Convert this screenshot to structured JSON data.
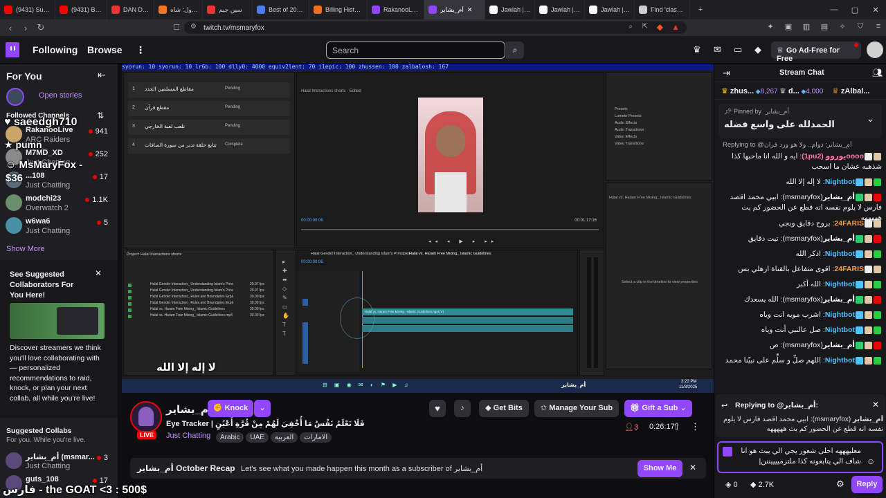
{
  "browser": {
    "tabs": [
      {
        "title": "(9431) Subscriptions",
        "color": "#ff0000"
      },
      {
        "title": "(9431) BEST OF",
        "color": "#ff0000"
      },
      {
        "title": "DAN DA DAN S",
        "color": "#e33"
      },
      {
        "title": "كرانشي رول: شاه",
        "color": "#f47521"
      },
      {
        "title": "سين جيم",
        "color": "#e33"
      },
      {
        "title": "Best of 2025: To",
        "color": "#4d7cf4"
      },
      {
        "title": "Billing History",
        "color": "#f26d21"
      },
      {
        "title": "RakanooLive",
        "color": "#9147ff"
      },
      {
        "title": "أم_بشاير",
        "color": "#9147ff",
        "active": true
      },
      {
        "title": "Jawlah | جولة -",
        "color": "#ffffff"
      },
      {
        "title": "Jawlah | جولة -",
        "color": "#ffffff"
      },
      {
        "title": "Jawlah | جولة -",
        "color": "#ffffff"
      },
      {
        "title": "Find 'class wars",
        "color": "#ccc"
      }
    ],
    "url": "twitch.tv/msmaryfox",
    "new_tab": "+",
    "minimize": "—",
    "maximize": "▢",
    "close": "✕"
  },
  "nav": {
    "following": "Following",
    "browse": "Browse",
    "more": "⋮",
    "search_placeholder": "Search",
    "adfree": "Go Ad-Free for Free"
  },
  "sidebar": {
    "for_you": "For You",
    "open_stories": "Open stories",
    "followed_channels": "Followed Channels",
    "channels": [
      {
        "name": "RakanooLive",
        "category": "ARC Raiders",
        "viewers": "941",
        "color": "#c9a66b"
      },
      {
        "name": "M7MD_XD",
        "category": "Just Chatting",
        "viewers": "252",
        "color": "#8a8a8a"
      },
      {
        "name": "...108",
        "category": "Just Chatting",
        "viewers": "17",
        "color": "#5a6b7a"
      },
      {
        "name": "modchi23",
        "category": "Overwatch 2",
        "viewers": "1.1K",
        "color": "#6b8e6b"
      },
      {
        "name": "w6wa6",
        "category": "Just Chatting",
        "viewers": "5",
        "color": "#4a90a4"
      }
    ],
    "show_more": "Show More",
    "suggest_title": "See Suggested Collaborators For You Here!",
    "suggest_body": "Discover streamers we think you'll love collaborating with — personalized recommendations to raid, knock, or plan your next collab, all while you're live!",
    "suggested_collabs": "Suggested Collabs",
    "suggested_sub": "For you. While you're live.",
    "collabs": [
      {
        "name": "أم_بشاير (msmar...",
        "category": "Just Chatting",
        "viewers": "3"
      },
      {
        "name": "guts_108",
        "category": "",
        "viewers": "17"
      }
    ]
  },
  "overlay": {
    "alert1": "saeedgh710",
    "alert2": "pumn_",
    "alert3": "MsMaryFox - $36",
    "bottom": "فارس - the GOAT <3 : 500$",
    "video_caption": "لا إله إلا الله"
  },
  "premiere": {
    "ticker": "syorun: 10  syorun: 10  lr6b: 100  dlly0: 4000  equiv2lent: 70  i1epic: 100  zhussen: 100  zalbalosh: 167",
    "queue": [
      {
        "n": "1",
        "title": "مقاطع المسلمين الجدد",
        "status": "Pending"
      },
      {
        "n": "2",
        "title": "مقطع قرآن",
        "status": "Pending"
      },
      {
        "n": "3",
        "title": "تلعب لعبة الخارجي",
        "status": "Pending"
      },
      {
        "n": "4",
        "title": "تتابع حلقة تدبر من سورة الصافات",
        "status": "Complete"
      }
    ],
    "program_title": "Halal Interactions shorts - Edited",
    "timecode_in": "00:00:00:06",
    "timecode_out": "00:01:17:16",
    "project_title": "Project: Halal Interactions shorts",
    "files": [
      "Halal Gender Interaction_ Understanding Islam's Principles",
      "Halal Gender Interaction_ Understanding Islam's Principles.mp4",
      "Halal Gender Interaction_ Rules and Boundaries Explained",
      "Halal Gender Interaction_ Rules and Boundaries Explained.mp4",
      "Halal vs. Haram Free Mixing_ Islamic Guidelines",
      "Halal vs. Haram Free Mixing_ Islamic Guidelines.mp4"
    ],
    "frame_rates": [
      "29.97 fps",
      "29.97 fps",
      "30.00 fps",
      "30.00 fps",
      "30.00 fps",
      "30.00 fps"
    ],
    "seq_tab1": "Halal Gender Interaction_ Understanding Islam's Principles",
    "seq_tab2": "Halal vs. Haram Free Mixing_ Islamic Guidelines",
    "clip_label": "Halal vs. Haram Free Mixing_ Islamic Guidelines.mp4 [V]",
    "properties": "Select a clip in the timeline to view properties",
    "properties_title": "Halal vs. Haram Free Mixing_ Islamic Guidelines",
    "effects": [
      "Presets",
      "Lumetri Presets",
      "Audio Effects",
      "Audio Transitions",
      "Video Effects",
      "Video Transitions"
    ],
    "taskbar_name": "أم_بشاير",
    "clock": "3:22 PM",
    "date": "11/3/2025"
  },
  "stream": {
    "channel": "أم_بشاير",
    "knock": "Knock",
    "title": "Eye Tracker | فَلَا تَعْلَمُ نَفْسٌ مَا أُخْفِيَ لَهُمْ مِنْ قُرَّةِ أَعْيُنٍ",
    "category": "Just Chatting",
    "tags": [
      "Arabic",
      "UAE",
      "العربية",
      "الامارات"
    ],
    "live": "LIVE",
    "get_bits": "Get Bits",
    "manage_sub": "Manage Your Sub",
    "gift_sub": "Gift a Sub",
    "viewers": "3",
    "uptime": "0:26:17",
    "recap_title": "أم_بشاير October Recap",
    "recap_body": "Let's see what you made happen this month as a subscriber of أم_بشاير",
    "show_me": "Show Me"
  },
  "chat": {
    "title": "Stream Chat",
    "leaderboard": [
      {
        "name": "zhus...",
        "amount": "8,267"
      },
      {
        "name": "d...",
        "amount": "4,000"
      },
      {
        "name": "zAlbal...",
        "amount": ""
      }
    ],
    "pinned_by": "Pinned by",
    "pinned_user": "أم_بشاير",
    "pinned_text": "الحمدلله على واسع فضله",
    "replying_line": "Replying to @أم_بشاير: دوام.. ولا هو ورد قرآن",
    "messages": [
      {
        "user": "ooooيوروو (1pu2)",
        "color": "#ff7bb0",
        "text": ": ايه و الله انا ماحبها كذا شذهبه عشان ما اسحب"
      },
      {
        "user": "Nightbot",
        "color": "#4ec4ff",
        "text": ": لا إله إلا الله"
      },
      {
        "user": "أم_بشاير",
        "color": "#ffffff",
        "text": "(msmaryfox): ابيي محمد اقصد فارس لا يلوم نفسه انه قطع عن الحضور كم بث هههههه"
      },
      {
        "user": "24FARIS",
        "color": "#ff9a3c",
        "text": ": بروح دقايق وبجي"
      },
      {
        "user": "أم_بشاير",
        "color": "#ffffff",
        "text": "(msmaryfox): تيت دقايق"
      },
      {
        "user": "Nightbot",
        "color": "#4ec4ff",
        "text": ": اذكر الله"
      },
      {
        "user": "24FARIS",
        "color": "#ff9a3c",
        "text": ": اقوى متفاعل بالقناة ازهلي بس"
      },
      {
        "user": "Nightbot",
        "color": "#4ec4ff",
        "text": ": الله أكبر"
      },
      {
        "user": "أم_بشاير",
        "color": "#ffffff",
        "text": "(msmaryfox): الله يسعدك"
      },
      {
        "user": "Nightbot",
        "color": "#4ec4ff",
        "text": ": اشرب مويه انت وياه"
      },
      {
        "user": "Nightbot",
        "color": "#4ec4ff",
        "text": ": صل عالنبي أنت وياه"
      },
      {
        "user": "أم_بشاير",
        "color": "#ffffff",
        "text": "(msmaryfox): ص"
      },
      {
        "user": "Nightbot",
        "color": "#4ec4ff",
        "text": ": اللهم صلِّ و سلِّم على نبيّنا محمد"
      }
    ],
    "reply_header": "Replying to @أم_بشاير:",
    "reply_quote": "ابيي محمد اقصد فارس لا يلوم نفسه انه قطع عن الحضور كم بث هههههه",
    "reply_user": "أم_بشاير",
    "reply_user_handle": "(msmaryfox):",
    "input_text": "معليهههه احلى شعور يجي الي يبث هو انا شاف الي يتابعونه كذا ملتزمييييننن|",
    "points": "0",
    "bits_count": "2.7K",
    "reply_button": "Reply"
  },
  "colors": {
    "twitch_purple": "#9147ff",
    "live_red": "#eb0400"
  }
}
